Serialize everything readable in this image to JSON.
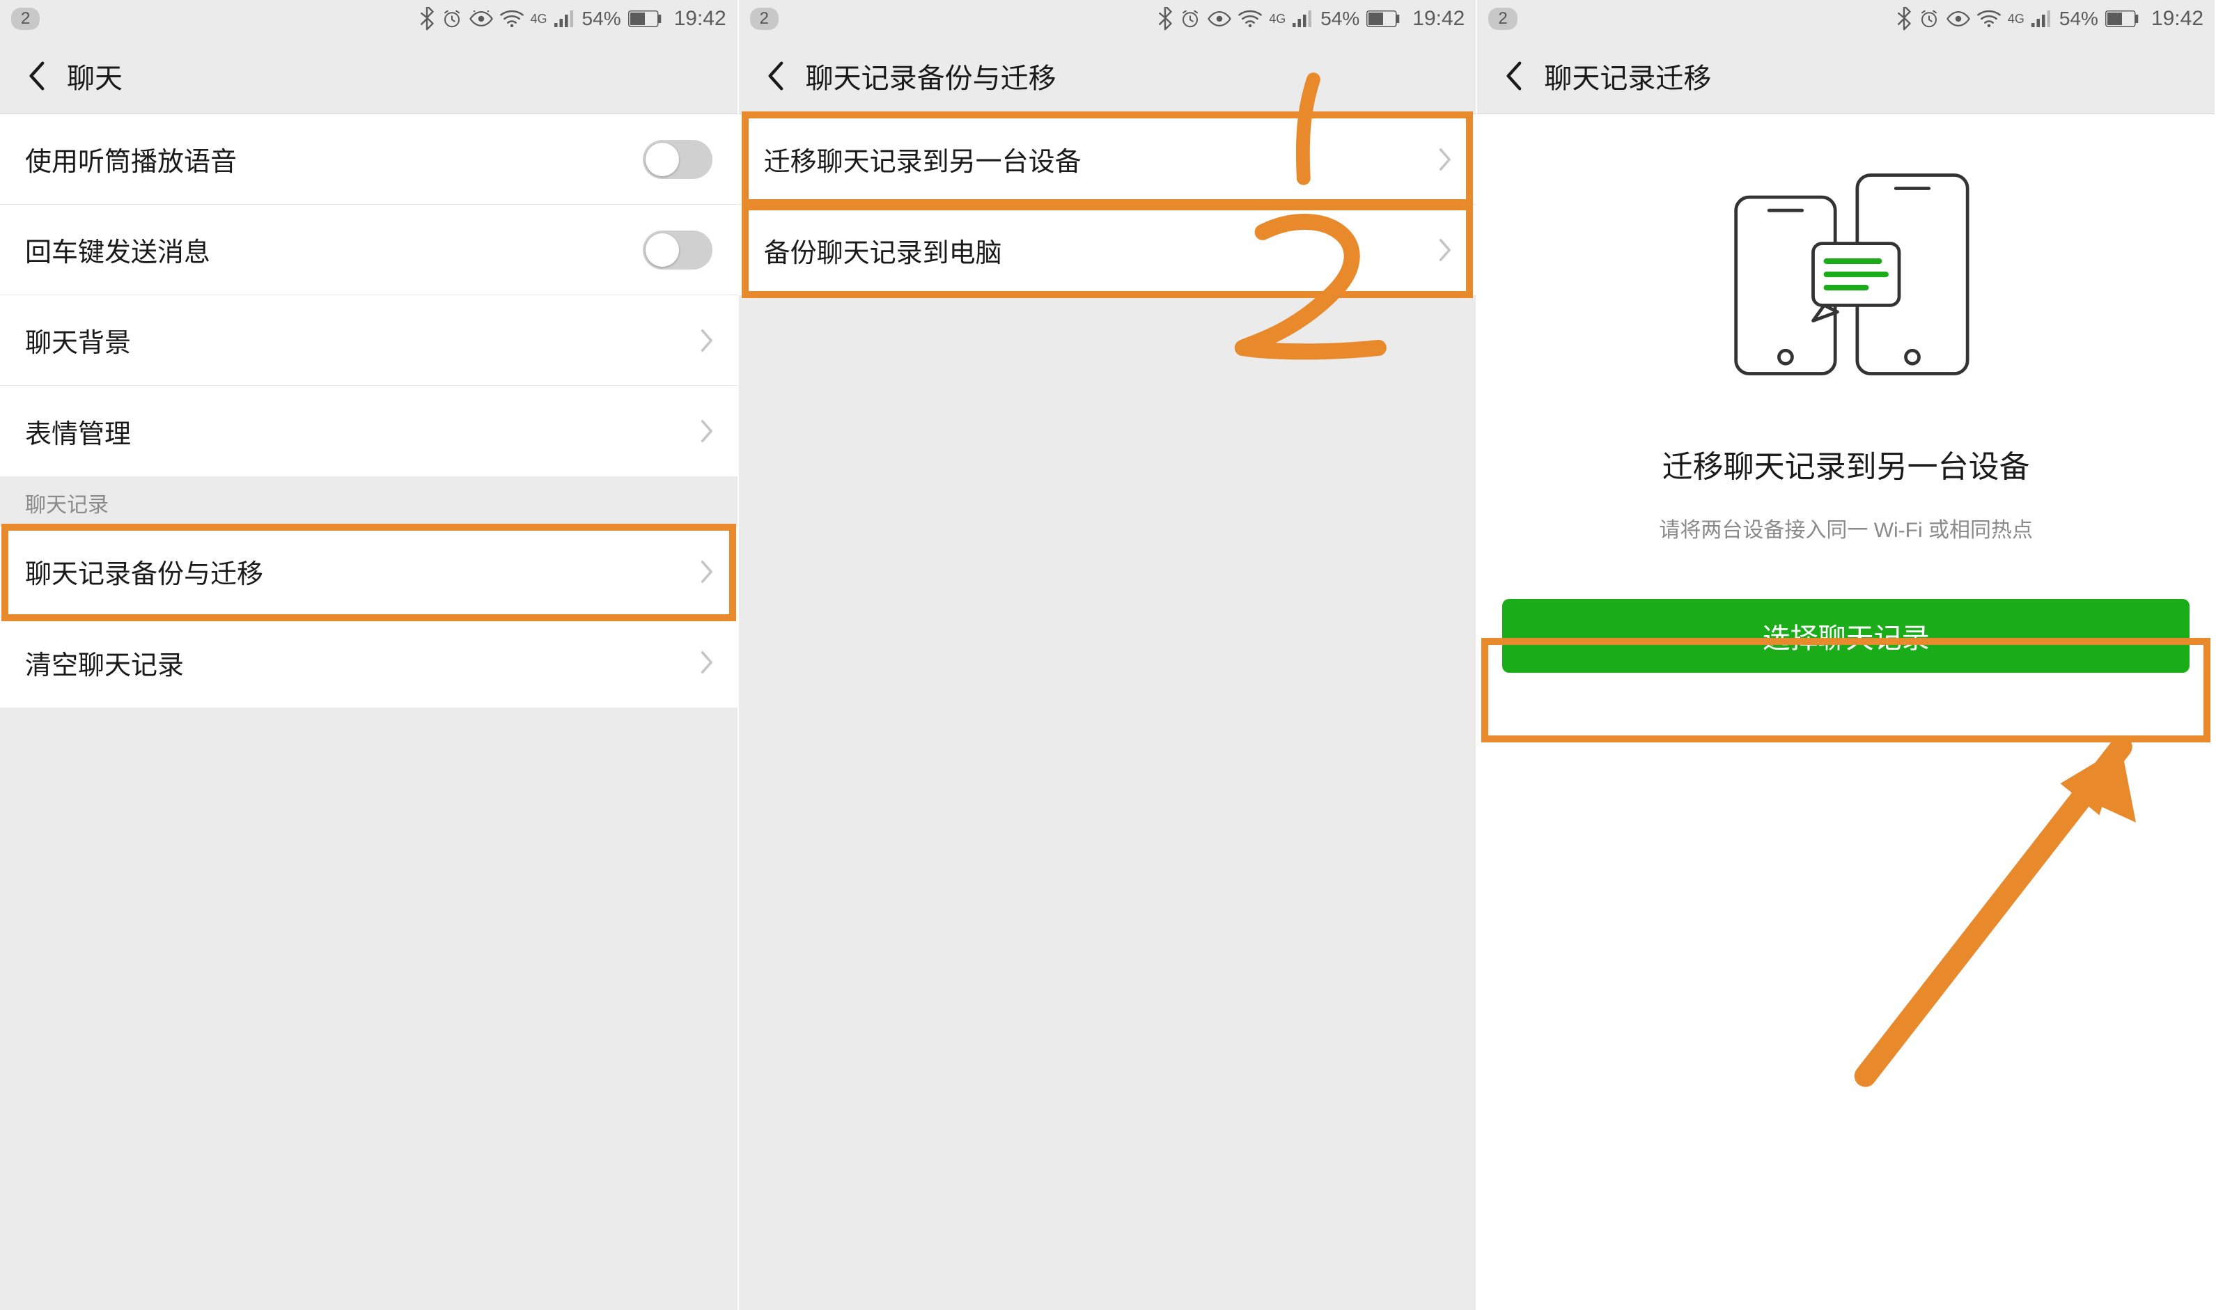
{
  "statusbar": {
    "notif_count": "2",
    "battery_pct": "54%",
    "time": "19:42",
    "signal_label": "4G"
  },
  "screen1": {
    "title": "聊天",
    "rows": {
      "use_earpiece": "使用听筒播放语音",
      "enter_send": "回车键发送消息",
      "chat_bg": "聊天背景",
      "sticker_mgmt": "表情管理"
    },
    "section_label": "聊天记录",
    "rows2": {
      "backup_migrate": "聊天记录备份与迁移",
      "clear_history": "清空聊天记录"
    }
  },
  "screen2": {
    "title": "聊天记录备份与迁移",
    "rows": {
      "migrate_device": "迁移聊天记录到另一台设备",
      "backup_pc": "备份聊天记录到电脑"
    },
    "annotations": {
      "one": "1",
      "two": "2"
    }
  },
  "screen3": {
    "title": "聊天记录迁移",
    "heading": "迁移聊天记录到另一台设备",
    "subtext": "请将两台设备接入同一 Wi-Fi 或相同热点",
    "button": "选择聊天记录"
  },
  "colors": {
    "highlight": "#e88a2b",
    "primary_green": "#1aad19"
  }
}
